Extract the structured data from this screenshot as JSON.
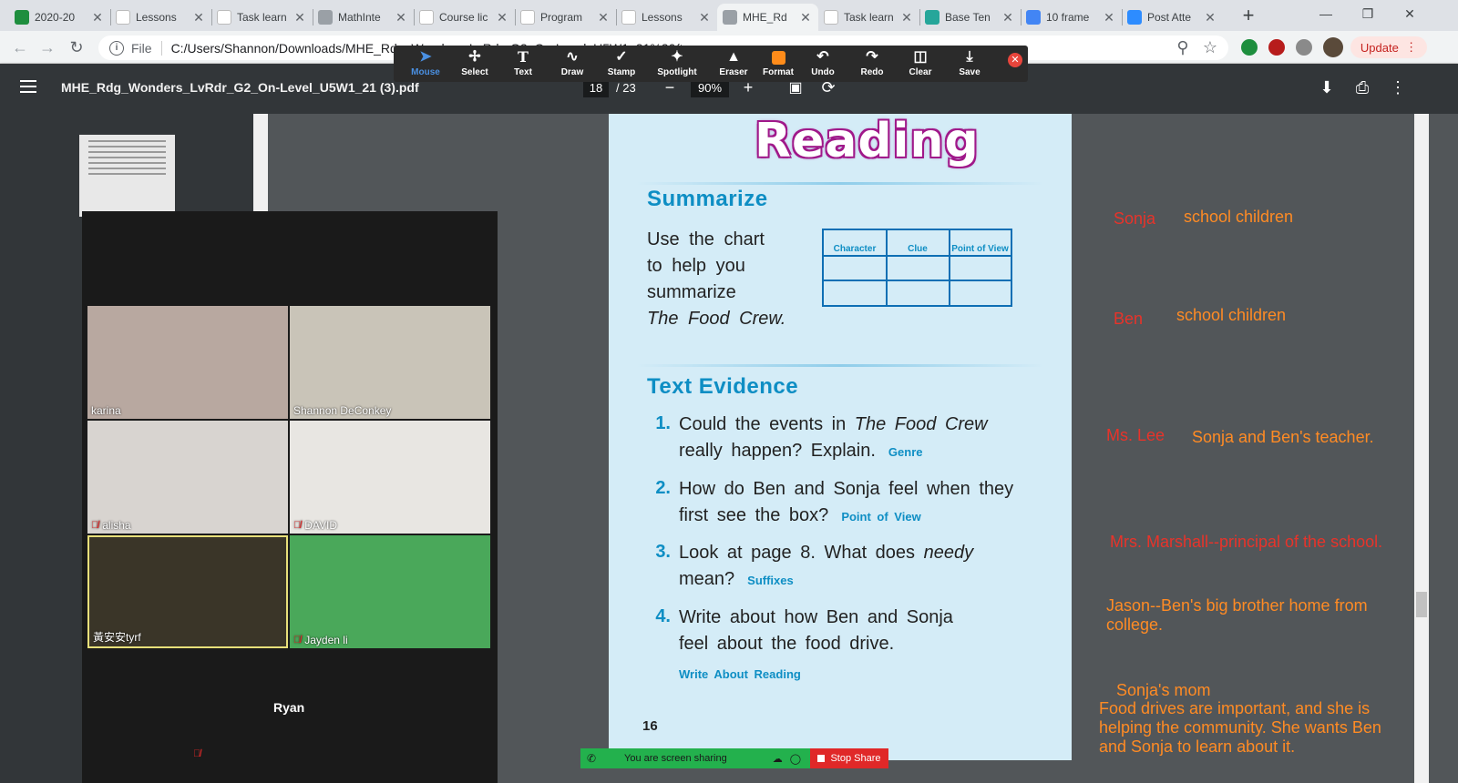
{
  "tabs": [
    {
      "label": "2020-20",
      "color": "#1e8e3e",
      "glyph": "+"
    },
    {
      "label": "Lessons",
      "color": "#ffffff",
      "glyph": ""
    },
    {
      "label": "Task learn",
      "color": "#ffffff",
      "glyph": ""
    },
    {
      "label": "MathInte",
      "color": "#9aa0a6",
      "glyph": ""
    },
    {
      "label": "Course lic",
      "color": "#ffffff",
      "glyph": ""
    },
    {
      "label": "Program",
      "color": "#ffffff",
      "glyph": ""
    },
    {
      "label": "Lessons",
      "color": "#ffffff",
      "glyph": ""
    },
    {
      "label": "MHE_Rd",
      "color": "#9aa0a6",
      "glyph": ""
    },
    {
      "label": "Task learn",
      "color": "#ffffff",
      "glyph": ""
    },
    {
      "label": "Base Ten",
      "color": "#26a69a",
      "glyph": ""
    },
    {
      "label": "10 frame",
      "color": "#4285f4",
      "glyph": ""
    },
    {
      "label": "Post Atte",
      "color": "#2d8cff",
      "glyph": ""
    }
  ],
  "address": {
    "scheme": "File",
    "url": "C:/Users/Shannon/Downloads/MHE_Rdg_Wonders_LvRdr_G2_On-Level_U5W1_21%20(3).pdf"
  },
  "update_label": "Update",
  "pdf": {
    "title": "MHE_Rdg_Wonders_LvRdr_G2_On-Level_U5W1_21 (3).pdf",
    "page_current": "18",
    "page_total": "/ 23",
    "zoom": "90%"
  },
  "annotate_tools": [
    "Mouse",
    "Select",
    "Text",
    "Draw",
    "Stamp",
    "Spotlight",
    "Eraser",
    "Format",
    "Undo",
    "Redo",
    "Clear",
    "Save"
  ],
  "page": {
    "title": "Reading",
    "summarize_heading": "Summarize",
    "summarize_lines": [
      "Use the chart",
      "to help you",
      "summarize",
      "The Food Crew."
    ],
    "chart_headers": [
      "Character",
      "Clue",
      "Point of View"
    ],
    "evidence_heading": "Text Evidence",
    "questions": [
      {
        "num": "1.",
        "text": "Could the events in The Food Crew really happen? Explain.",
        "tag": "Genre"
      },
      {
        "num": "2.",
        "text": "How do Ben and Sonja feel when they first see the box?",
        "tag": "Point of View"
      },
      {
        "num": "3.",
        "text": "Look at page 8. What does needy mean?",
        "tag": "Suffixes"
      },
      {
        "num": "4.",
        "text": "Write about how Ben and Sonja feel about the food drive.",
        "tag": "Write About Reading"
      }
    ],
    "page_number": "16"
  },
  "participants": [
    {
      "name": "karina",
      "muted": false,
      "bg": "#b8a8a0"
    },
    {
      "name": "Shannon DeConkey",
      "muted": false,
      "bg": "#c9c4b8"
    },
    {
      "name": "alisha",
      "muted": true,
      "bg": "#d8d4d0"
    },
    {
      "name": "DAVID",
      "muted": true,
      "bg": "#e8e6e2"
    },
    {
      "name": "黃安安tyrf",
      "muted": false,
      "bg": "#3a3528"
    },
    {
      "name": "Jayden li",
      "muted": true,
      "bg": "#4aa85a"
    }
  ],
  "ryan": "Ryan",
  "share": {
    "status": "You are screen sharing",
    "stop": "Stop Share"
  },
  "notes": [
    {
      "text": "Sonja",
      "cls": "red"
    },
    {
      "text": "school children",
      "cls": "org"
    },
    {
      "text": "Ben",
      "cls": "red"
    },
    {
      "text": "school children",
      "cls": "org"
    },
    {
      "text": "Ms. Lee",
      "cls": "red"
    },
    {
      "text": "Sonja and Ben's teacher.",
      "cls": "org"
    },
    {
      "text": "Mrs. Marshall--principal of the school.",
      "cls": "red"
    },
    {
      "text": "Jason--Ben's big brother home from college.",
      "cls": "org"
    },
    {
      "text": "Sonja's mom",
      "cls": "org"
    },
    {
      "text": "Food drives are important, and she is helping the community. She wants Ben and Sonja to learn about it.",
      "cls": "org"
    }
  ]
}
